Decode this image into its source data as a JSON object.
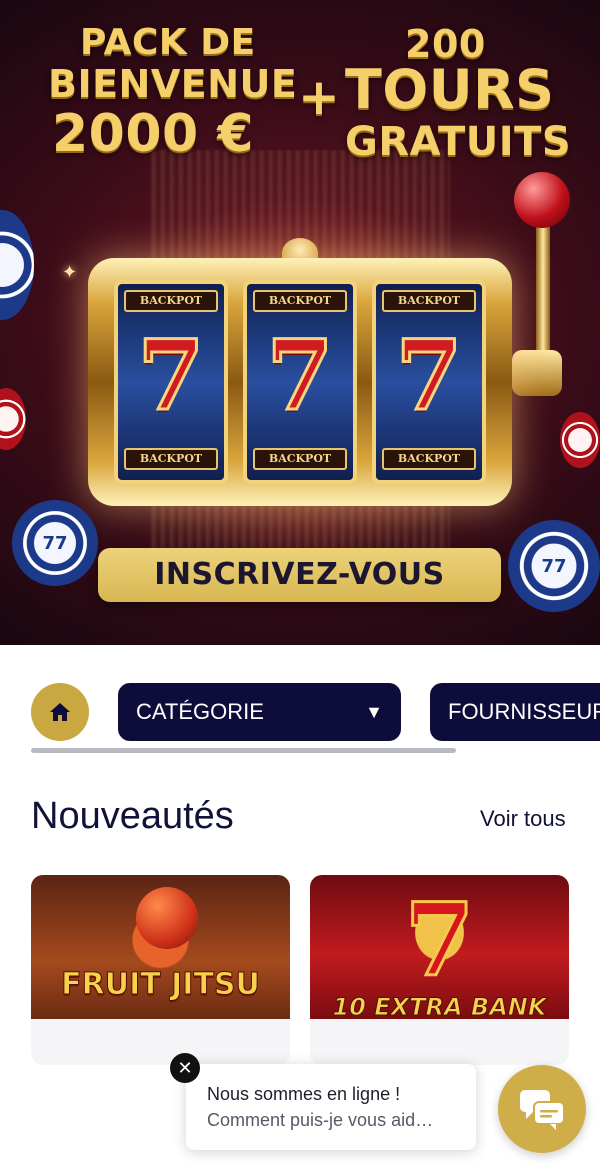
{
  "banner": {
    "promo_left_1": "PACK DE",
    "promo_left_2": "BIENVENUE",
    "promo_left_3": "2000 €",
    "promo_plus": "+",
    "promo_right_1": "200",
    "promo_right_2": "TOURS",
    "promo_right_3": "GRATUITS",
    "reel_label": "BACKPOT",
    "reel_symbol": "7",
    "chip_label": "77",
    "cta_label": "INSCRIVEZ-VOUS"
  },
  "nav": {
    "home_icon": "home-icon",
    "category_label": "CATÉGORIE",
    "category_caret": "▼",
    "provider_label": "FOURNISSEURS"
  },
  "section": {
    "title": "Nouveautés",
    "see_all": "Voir tous"
  },
  "games": [
    {
      "title": "FRUIT JITSU"
    },
    {
      "title": "10 EXTRA BANK",
      "symbol": "7"
    }
  ],
  "chat": {
    "close_glyph": "✕",
    "line1": "Nous sommes en ligne !",
    "line2": "Comment puis-je vous aid…",
    "launcher_icon": "chat-icon"
  },
  "colors": {
    "gold": "#cfae4a",
    "navy": "#0e0c3b",
    "cta_text": "#1c1630"
  }
}
